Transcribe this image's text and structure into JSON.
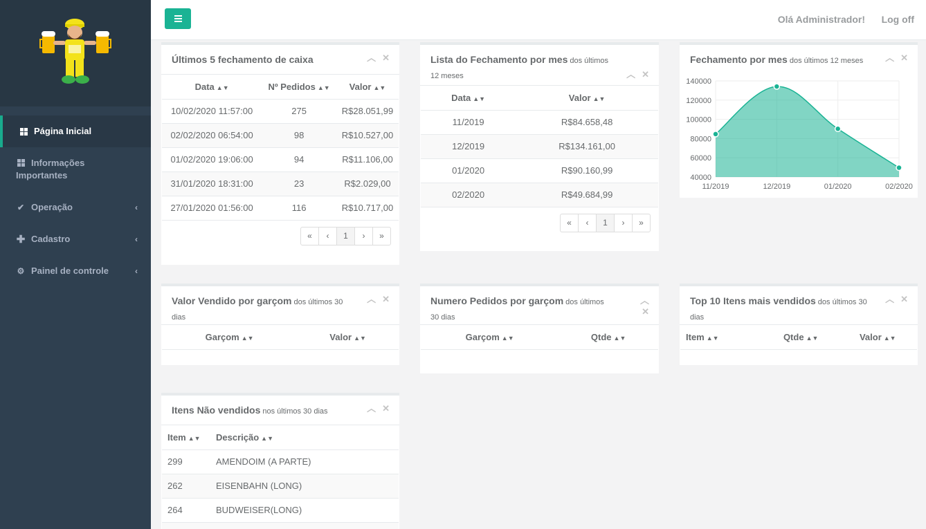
{
  "header": {
    "welcome": "Olá Administrador!",
    "logoff": "Log off"
  },
  "sidebar": {
    "items": [
      {
        "label": "Página Inicial",
        "icon": "grid-icon"
      },
      {
        "label": "Informações Importantes",
        "icon": "grid-icon"
      },
      {
        "label": "Operação",
        "icon": "check-icon"
      },
      {
        "label": "Cadastro",
        "icon": "plus-icon"
      },
      {
        "label": "Painel de controle",
        "icon": "cogs-icon"
      }
    ]
  },
  "panel_caixa": {
    "title": "Últimos 5 fechamento de caixa",
    "columns": [
      "Data",
      "Nº Pedidos",
      "Valor"
    ],
    "rows": [
      [
        "10/02/2020 11:57:00",
        "275",
        "R$28.051,99"
      ],
      [
        "02/02/2020 06:54:00",
        "98",
        "R$10.527,00"
      ],
      [
        "01/02/2020 19:06:00",
        "94",
        "R$11.106,00"
      ],
      [
        "31/01/2020 18:31:00",
        "23",
        "R$2.029,00"
      ],
      [
        "27/01/2020 01:56:00",
        "116",
        "R$10.717,00"
      ]
    ],
    "pager": [
      "«",
      "‹",
      "1",
      "›",
      "»"
    ]
  },
  "panel_mes": {
    "title": "Lista do Fechamento por mes",
    "subtitle": "dos últimos 12 meses",
    "columns": [
      "Data",
      "Valor"
    ],
    "rows": [
      [
        "11/2019",
        "R$84.658,48"
      ],
      [
        "12/2019",
        "R$134.161,00"
      ],
      [
        "01/2020",
        "R$90.160,99"
      ],
      [
        "02/2020",
        "R$49.684,99"
      ]
    ],
    "pager": [
      "«",
      "‹",
      "1",
      "›",
      "»"
    ]
  },
  "panel_chart": {
    "title": "Fechamento por mes",
    "subtitle": "dos últimos 12 meses"
  },
  "chart_data": {
    "type": "area",
    "categories": [
      "11/2019",
      "12/2019",
      "01/2020",
      "02/2020"
    ],
    "values": [
      84658.48,
      134161.0,
      90160.99,
      49684.99
    ],
    "ylim": [
      40000,
      140000
    ],
    "yticks": [
      "140000",
      "120000",
      "100000",
      "80000",
      "60000",
      "40000"
    ],
    "color": "#1ab394",
    "grid": true
  },
  "panel_garcom_valor": {
    "title": "Valor Vendido por garçom",
    "subtitle": "dos últimos 30 dias",
    "columns": [
      "Garçom",
      "Valor"
    ]
  },
  "panel_garcom_pedidos": {
    "title": "Numero Pedidos por garçom",
    "subtitle": "dos últimos 30 dias",
    "columns": [
      "Garçom",
      "Qtde"
    ]
  },
  "panel_top10": {
    "title": "Top 10 Itens mais vendidos",
    "subtitle": "dos últimos 30 dias",
    "columns": [
      "Item",
      "Qtde",
      "Valor"
    ]
  },
  "panel_naovendidos": {
    "title": "Itens Não vendidos",
    "subtitle": "nos últimos 30 dias",
    "columns": [
      "Item",
      "Descrição"
    ],
    "rows": [
      [
        "299",
        "AMENDOIM (A PARTE)"
      ],
      [
        "262",
        "EISENBAHN (LONG)"
      ],
      [
        "264",
        "BUDWEISER(LONG)"
      ]
    ]
  },
  "tools": {
    "collapse": "chevron-up-icon",
    "close": "close-icon"
  },
  "colors": {
    "sidebar": "#2f4050",
    "accent": "#1ab394"
  }
}
